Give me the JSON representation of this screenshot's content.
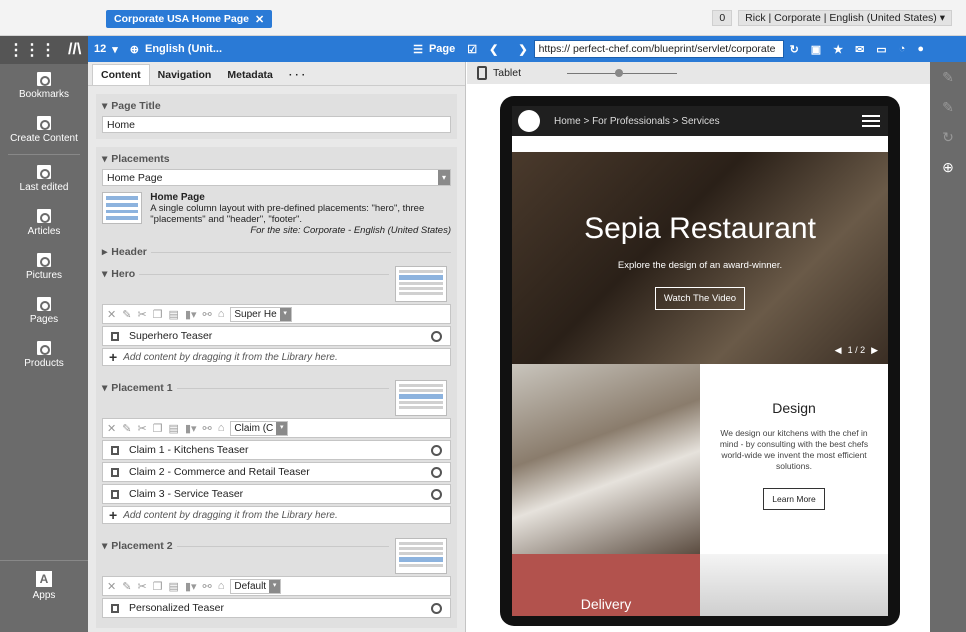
{
  "top": {
    "doc_tab": "Corporate USA Home Page",
    "count": "0",
    "user": "Rick | Corporate | English (United States)"
  },
  "leftnav": {
    "items": [
      {
        "label": "Bookmarks"
      },
      {
        "label": "Create Content"
      },
      {
        "label": "Last edited"
      },
      {
        "label": "Articles"
      },
      {
        "label": "Pictures"
      },
      {
        "label": "Pages"
      },
      {
        "label": "Products"
      }
    ],
    "apps": "Apps"
  },
  "toolbar": {
    "version": "12",
    "language": "English (Unit...",
    "page_label": "Page",
    "url": "https:// perfect-chef.com/blueprint/servlet/corporate"
  },
  "panel": {
    "tabs": [
      "Content",
      "Navigation",
      "Metadata",
      "· · ·"
    ],
    "page_title_label": "Page Title",
    "page_title_value": "Home",
    "placements_label": "Placements",
    "layout_select": "Home Page",
    "layout_name": "Home Page",
    "layout_desc": "A single column layout with pre-defined placements: \"hero\", three \"placements\" and \"header\", \"footer\".",
    "layout_site": "For the site: Corporate - English (United States)",
    "header_label": "Header",
    "hero_label": "Hero",
    "hero_select": "Super He",
    "hero_items": [
      "Superhero Teaser"
    ],
    "add_hint": "Add content by dragging it from the Library here.",
    "p1_label": "Placement 1",
    "p1_select": "Claim (C",
    "p1_items": [
      "Claim 1 - Kitchens Teaser",
      "Claim 2 - Commerce and Retail Teaser",
      "Claim 3 - Service Teaser"
    ],
    "p2_label": "Placement 2",
    "p2_select": "Default",
    "p2_items": [
      "Personalized Teaser"
    ]
  },
  "preview": {
    "device": "Tablet",
    "breadcrumb": "Home  >  For Professionals  >  Services",
    "hero_title": "Sepia Restaurant",
    "hero_sub": "Explore the design of an award-winner.",
    "hero_button": "Watch The Video",
    "pager": "1 / 2",
    "design_title": "Design",
    "design_text": "We design our kitchens with the chef in mind - by consulting with the best chefs world-wide we invent the most efficient solutions.",
    "design_button": "Learn More",
    "delivery_title": "Delivery"
  }
}
